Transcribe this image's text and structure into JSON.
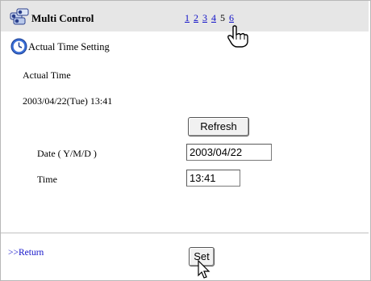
{
  "header": {
    "title": "Multi Control",
    "pages": [
      {
        "label": "1",
        "current": false
      },
      {
        "label": "2",
        "current": false
      },
      {
        "label": "3",
        "current": false
      },
      {
        "label": "4",
        "current": false
      },
      {
        "label": "5",
        "current": true
      },
      {
        "label": "6",
        "current": false
      }
    ]
  },
  "section": {
    "title": "Actual Time Setting"
  },
  "current_time": {
    "label": "Actual Time",
    "value": "2003/04/22(Tue) 13:41",
    "refresh_label": "Refresh"
  },
  "form": {
    "date_label": "Date ( Y/M/D )",
    "date_value": "2003/04/22",
    "time_label": "Time",
    "time_value": "13:41"
  },
  "footer": {
    "return_label": ">>Return",
    "set_label": "Set"
  },
  "colors": {
    "header_bg": "#e6e6e6",
    "link": "#1010c8"
  }
}
